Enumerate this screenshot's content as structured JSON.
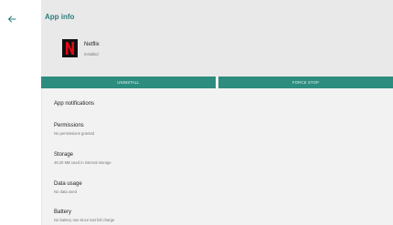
{
  "header": {
    "title": "App info"
  },
  "app": {
    "name": "Netflix",
    "status": "Installed",
    "icon_letter": "N"
  },
  "actions": {
    "uninstall": "UNINSTALL",
    "force_stop": "FORCE STOP"
  },
  "settings": [
    {
      "title": "App notifications",
      "subtitle": ""
    },
    {
      "title": "Permissions",
      "subtitle": "No permissions granted"
    },
    {
      "title": "Storage",
      "subtitle": "48.20 MB used in internal storage"
    },
    {
      "title": "Data usage",
      "subtitle": "No data used"
    },
    {
      "title": "Battery",
      "subtitle": "No battery use since last full charge"
    }
  ],
  "colors": {
    "accent": "#2c8d7f",
    "title": "#2a7d7b",
    "netflix_red": "#e50914"
  },
  "icons": {
    "back": "back-arrow-icon",
    "app": "netflix-logo-icon"
  }
}
